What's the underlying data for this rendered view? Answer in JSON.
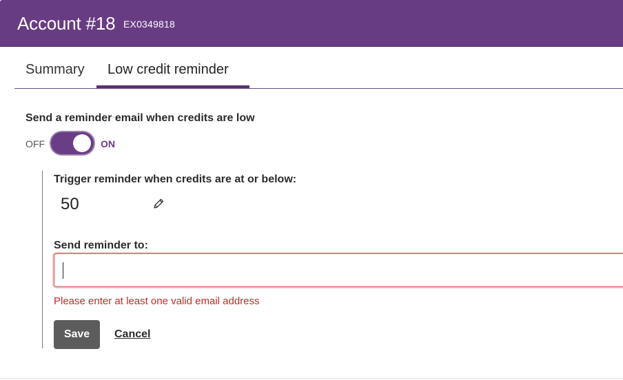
{
  "header": {
    "title": "Account #18",
    "account_id": "EX0349818"
  },
  "tabs": [
    {
      "label": "Summary",
      "active": false
    },
    {
      "label": "Low credit reminder",
      "active": true
    }
  ],
  "reminder": {
    "heading": "Send a reminder email when credits are low",
    "toggle": {
      "off_label": "OFF",
      "on_label": "ON",
      "state": "on"
    },
    "threshold": {
      "label": "Trigger reminder when credits are at or below:",
      "value": "50"
    },
    "send_to": {
      "label": "Send reminder to:",
      "value": "",
      "placeholder": ""
    },
    "error": "Please enter at least one valid email address",
    "save_label": "Save",
    "cancel_label": "Cancel"
  },
  "icons": {
    "edit": "pencil-icon"
  },
  "colors": {
    "brand": "#683c83",
    "error": "#c42a2a",
    "save_button": "#5c5c5c"
  }
}
